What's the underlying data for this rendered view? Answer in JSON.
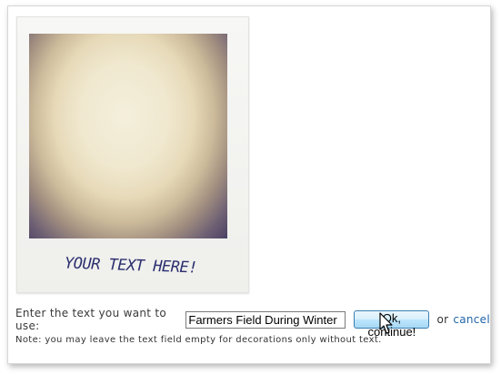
{
  "preview": {
    "placeholder_text": "YOUR TEXT HERE!"
  },
  "form": {
    "prompt_label": "Enter the text you want to use:",
    "text_value": "Farmers Field During Winter",
    "ok_label": "Ok, continue!",
    "or_label": "or",
    "cancel_label": "cancel"
  },
  "note": {
    "text": "Note: you may leave the text field empty for decorations only without text."
  },
  "colors": {
    "link": "#2266aa",
    "handwriting": "#2b2f6e",
    "button_border": "#3c7fb1"
  },
  "icons": {
    "cursor": "hand-pointer-icon"
  }
}
